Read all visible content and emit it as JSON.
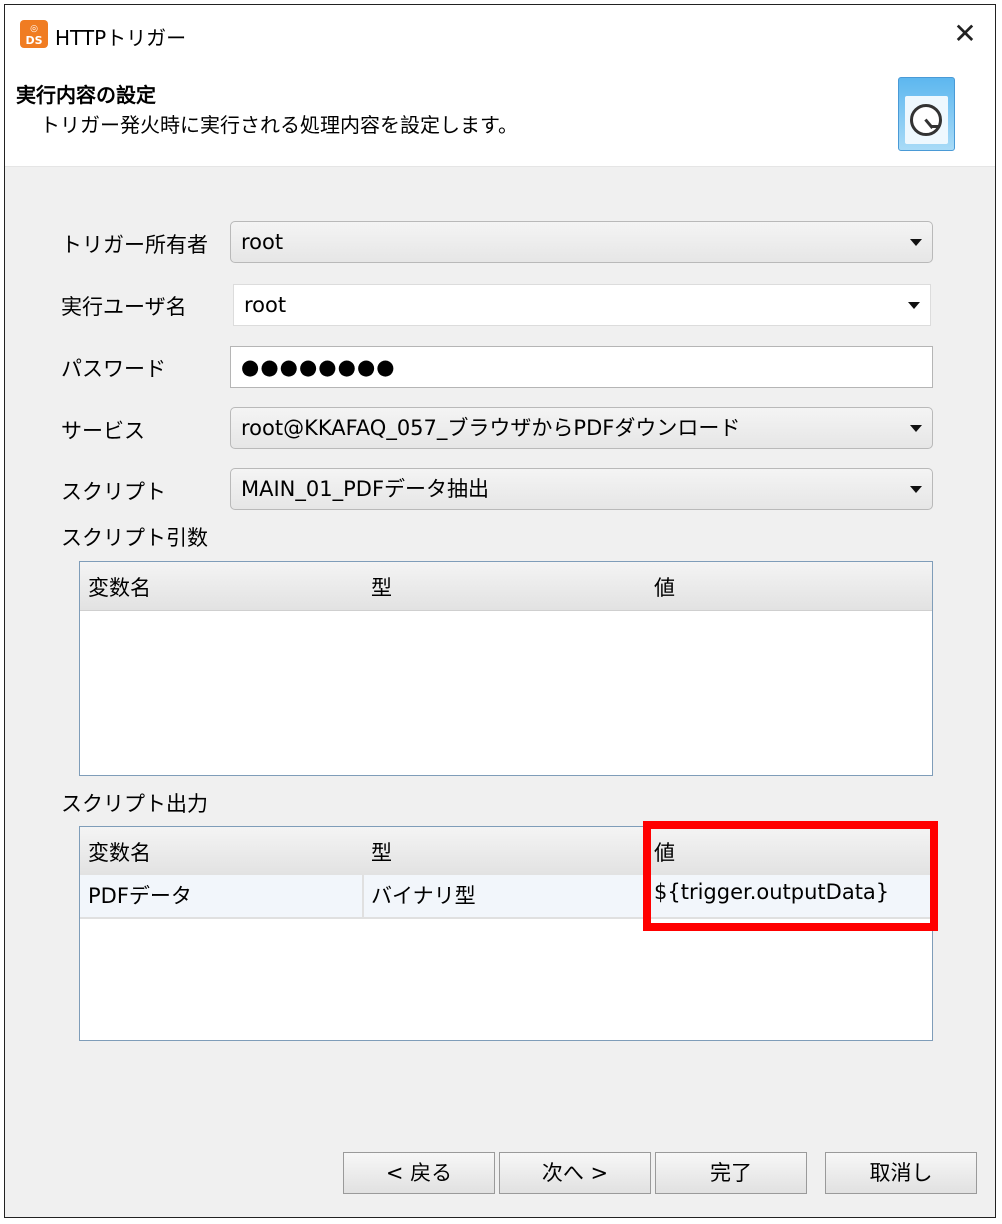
{
  "window": {
    "title": "HTTPトリガー",
    "app_icon_text": "DS"
  },
  "banner": {
    "title": "実行内容の設定",
    "description": "トリガー発火時に実行される処理内容を設定します。"
  },
  "form": {
    "owner": {
      "label": "トリガー所有者",
      "value": "root"
    },
    "exec_user": {
      "label": "実行ユーザ名",
      "value": "root"
    },
    "password": {
      "label": "パスワード",
      "value": "●●●●●●●●"
    },
    "service": {
      "label": "サービス",
      "value": "root@KKAFAQ_057_ブラウザからPDFダウンロード"
    },
    "script": {
      "label": "スクリプト",
      "value": "MAIN_01_PDFデータ抽出"
    }
  },
  "script_args": {
    "label": "スクリプト引数",
    "columns": [
      "変数名",
      "型",
      "値"
    ],
    "rows": []
  },
  "script_output": {
    "label": "スクリプト出力",
    "columns": [
      "変数名",
      "型",
      "値"
    ],
    "rows": [
      {
        "name": "PDFデータ",
        "type": "バイナリ型",
        "value": "${trigger.outputData}"
      }
    ]
  },
  "buttons": {
    "back": "< 戻る",
    "next": "次へ >",
    "finish": "完了",
    "cancel": "取消し"
  },
  "colors": {
    "highlight": "#ff0000",
    "accent": "#f07c22"
  }
}
